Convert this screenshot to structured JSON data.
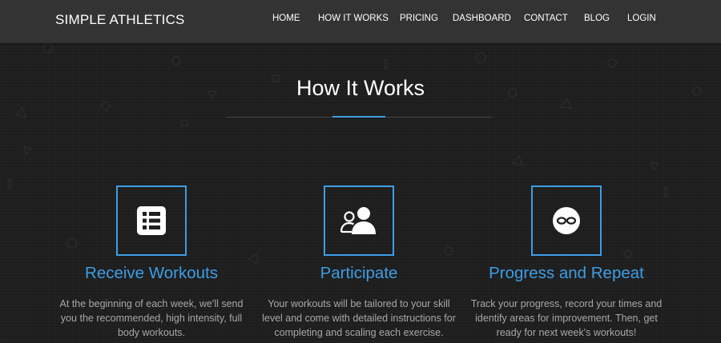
{
  "brand": "SIMPLE ATHLETICS",
  "nav": {
    "items": [
      "HOME",
      "HOW IT WORKS",
      "PRICING",
      "DASHBOARD",
      "CONTACT",
      "BLOG",
      "LOGIN"
    ]
  },
  "section": {
    "title": "How It Works"
  },
  "features": [
    {
      "icon": "list-icon",
      "title": "Receive Workouts",
      "text": "At the beginning of each week, we'll send you the recommended, high intensity, full body workouts."
    },
    {
      "icon": "users-icon",
      "title": "Participate",
      "text": "Your workouts will be tailored to your skill level and come with detailed instructions for completing and scaling each exercise."
    },
    {
      "icon": "infinity-icon",
      "title": "Progress and Repeat",
      "text": "Track your progress, record your times and identify areas for improvement. Then, get ready for next week's workouts!"
    }
  ],
  "colors": {
    "accent": "#3c9ee5",
    "navbar": "#333333",
    "background": "#1f1f1f",
    "body_text": "#a8a8a8"
  }
}
